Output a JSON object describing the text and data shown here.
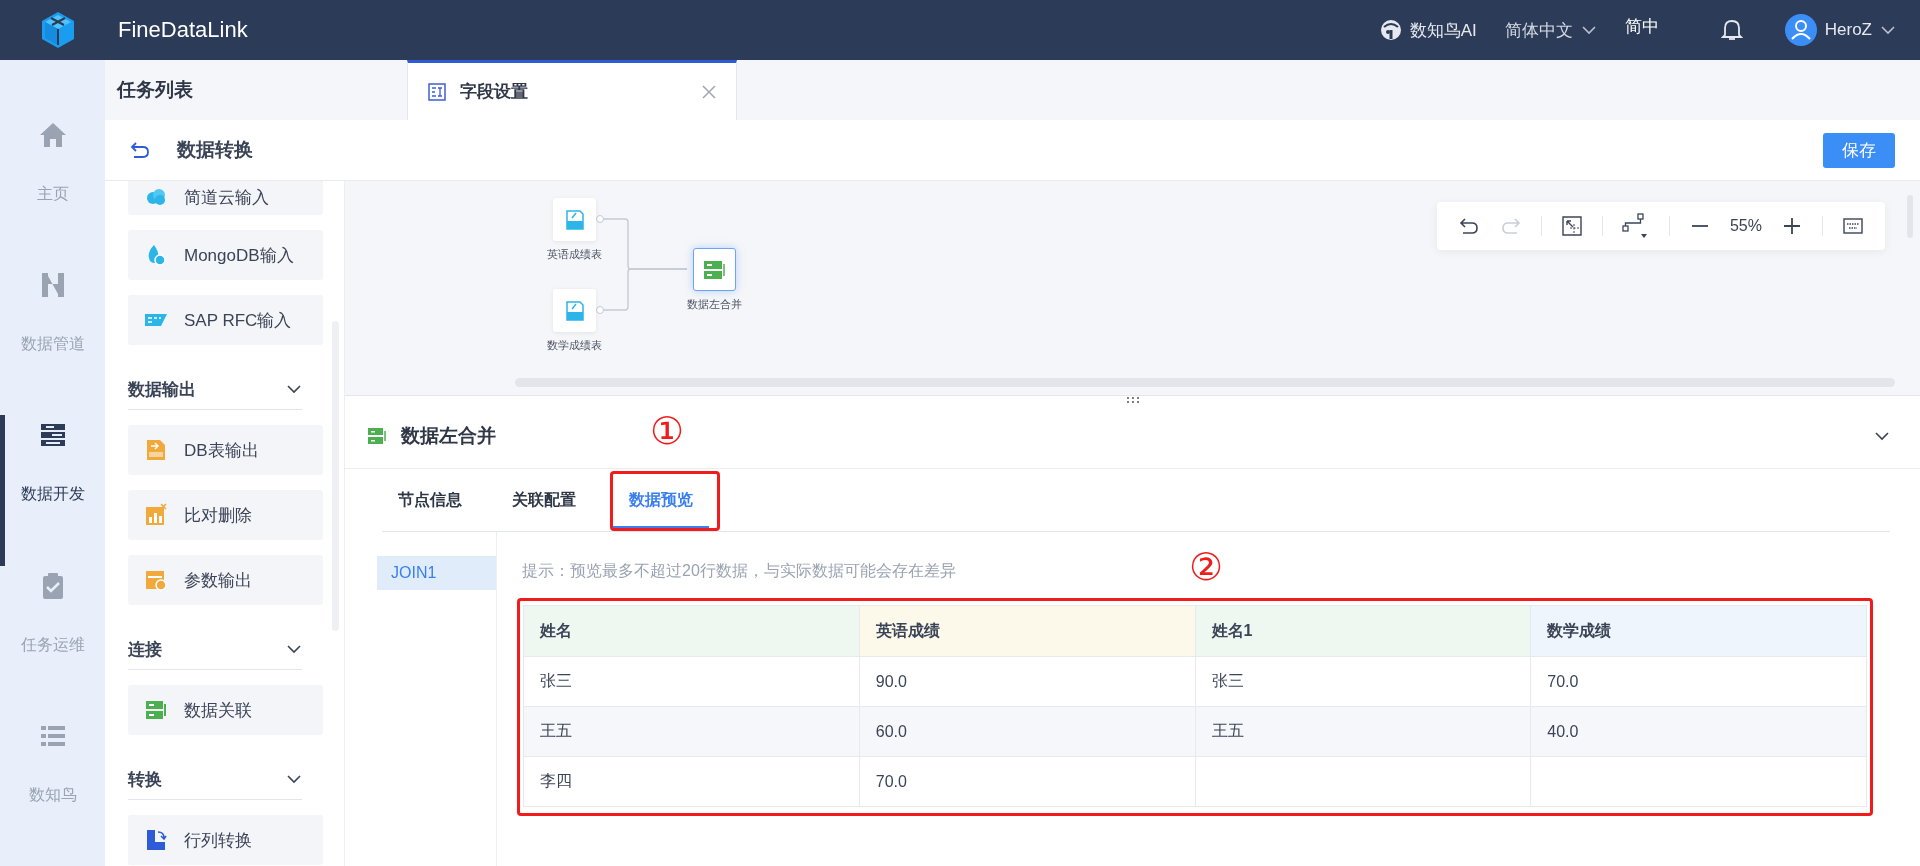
{
  "header": {
    "brand": "FineDataLink",
    "ai": "数知鸟AI",
    "language": "简体中文",
    "lang_short": "简中",
    "user": "HeroZ"
  },
  "nav": [
    {
      "label": "主页",
      "selected": false
    },
    {
      "label": "数据管道",
      "selected": false
    },
    {
      "label": "数据开发",
      "selected": true
    },
    {
      "label": "任务运维",
      "selected": false
    },
    {
      "label": "数知鸟",
      "selected": false
    }
  ],
  "task_list_title": "任务列表",
  "tabs": [
    {
      "label": "字段设置",
      "selected": true
    }
  ],
  "page_title": "数据转换",
  "save_button": "保存",
  "palette": [
    {
      "items": [
        "简道云输入",
        "MongoDB输入",
        "SAP RFC输入"
      ]
    },
    {
      "title": "数据输出",
      "expanded": true,
      "items": [
        "DB表输出",
        "比对删除",
        "参数输出"
      ]
    },
    {
      "title": "连接",
      "expanded": true,
      "items": [
        "数据关联"
      ]
    },
    {
      "title": "转换",
      "expanded": true,
      "items": [
        "行列转换"
      ]
    }
  ],
  "canvas": {
    "nodes": [
      {
        "kind": "db",
        "label": "英语成绩表",
        "selected": false
      },
      {
        "kind": "db",
        "label": "数学成绩表",
        "selected": false
      },
      {
        "kind": "join",
        "label": "数据左合并",
        "selected": true
      }
    ],
    "toolbar": {
      "undo_disabled": false,
      "redo_disabled": true,
      "zoom": "55%"
    }
  },
  "panel": {
    "title": "数据左合并",
    "annotation_1": "①",
    "annotation_2": "②",
    "tabs": [
      {
        "label": "节点信息",
        "selected": false
      },
      {
        "label": "关联配置",
        "selected": false
      },
      {
        "label": "数据预览",
        "selected": true
      }
    ],
    "side_items": [
      {
        "label": "JOIN1",
        "selected": true
      }
    ],
    "hint": "提示：预览最多不超过20行数据，与实际数据可能会存在差异",
    "table": {
      "columns": [
        {
          "label": "姓名",
          "color": "#eef7f0"
        },
        {
          "label": "英语成绩",
          "color": "#fdf9ea"
        },
        {
          "label": "姓名1",
          "color": "#eef7f0"
        },
        {
          "label": "数学成绩",
          "color": "#eef5fc"
        }
      ],
      "rows": [
        [
          "张三",
          "90.0",
          "张三",
          "70.0"
        ],
        [
          "王五",
          "60.0",
          "王五",
          "40.0"
        ],
        [
          "李四",
          "70.0",
          "",
          ""
        ]
      ]
    }
  }
}
